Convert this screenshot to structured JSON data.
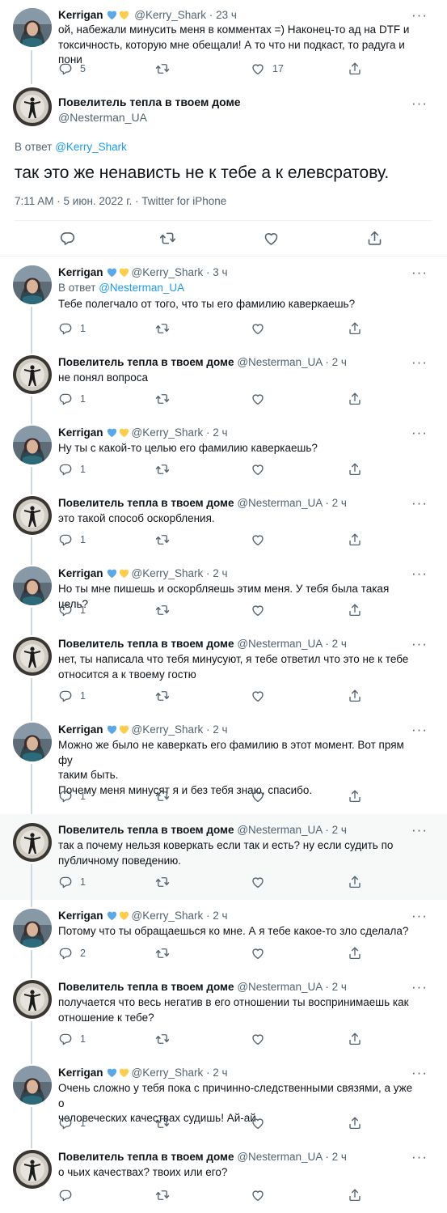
{
  "top_tweet": {
    "name": "Kerrigan",
    "handle": "@Kerry_Shark",
    "time": "23 ч",
    "text": "ой, набежали минусить меня в комментах =) Наконец-то ад на DTF и\nтоксичность, которую мне обещали! А то что ни подкаст, то радуга и пони",
    "replies": "5",
    "likes": "17"
  },
  "main_tweet": {
    "name": "Повелитель тепла в твоем доме",
    "handle": "@Nesterman_UA",
    "reply_prefix": "В ответ",
    "reply_to": "@Kerry_Shark",
    "text": "так это же ненависть не к тебе а к елевсратову.",
    "timestamp": "7:11 AM · 5 июн. 2022 г. · Twitter for iPhone"
  },
  "more_label": "···",
  "dot": "·",
  "colors": {
    "accent": "#1d9bf0",
    "secondary_text": "#536471",
    "heart_blue": "#5aa9e6",
    "heart_yellow": "#ffcc4d",
    "highlight_bg": "#f7f9f9"
  },
  "icons": [
    "reply-icon",
    "retweet-icon",
    "like-icon",
    "share-icon",
    "more-icon",
    "blue-heart-icon",
    "yellow-heart-icon"
  ],
  "replies": [
    {
      "author": "kerrigan",
      "name": "Kerrigan",
      "handle": "@Kerry_Shark",
      "time": "3 ч",
      "reply_prefix": "В ответ",
      "reply_to": "@Nesterman_UA",
      "text": "Тебе полегчало от того, что ты его фамилию каверкаешь?",
      "replies": "1"
    },
    {
      "author": "nesterman",
      "name": "Повелитель тепла в твоем доме",
      "handle": "@Nesterman_UA",
      "time": "2 ч",
      "text": "не понял вопроса",
      "replies": "1"
    },
    {
      "author": "kerrigan",
      "name": "Kerrigan",
      "handle": "@Kerry_Shark",
      "time": "2 ч",
      "text": "Ну ты с какой-то целью его фамилию каверкаешь?",
      "replies": "1"
    },
    {
      "author": "nesterman",
      "name": "Повелитель тепла в твоем доме",
      "handle": "@Nesterman_UA",
      "time": "2 ч",
      "text": "это такой способ оскорбления.",
      "replies": "1"
    },
    {
      "author": "kerrigan",
      "name": "Kerrigan",
      "handle": "@Kerry_Shark",
      "time": "2 ч",
      "text": "Но ты мне пишешь и оскорбляешь этим меня. У тебя была такая цель?",
      "replies": "1"
    },
    {
      "author": "nesterman",
      "name": "Повелитель тепла в твоем доме",
      "handle": "@Nesterman_UA",
      "time": "2 ч",
      "text": "нет, ты написала что тебя минусуют, я тебе ответил что это не к тебе\nотносится а к твоему гостю",
      "replies": "1"
    },
    {
      "author": "kerrigan",
      "name": "Kerrigan",
      "handle": "@Kerry_Shark",
      "time": "2 ч",
      "text": "Можно же было не каверкать его фамилию в этот момент. Вот прям фу\nтаким быть.\nПочему меня минусят я и без тебя знаю, спасибо.",
      "replies": "1"
    },
    {
      "author": "nesterman",
      "name": "Повелитель тепла в твоем доме",
      "handle": "@Nesterman_UA",
      "time": "2 ч",
      "text": "так а почему нельзя коверкать если так и есть? ну если судить по\nпубличному поведению.",
      "replies": "1",
      "highlight": true
    },
    {
      "author": "kerrigan",
      "name": "Kerrigan",
      "handle": "@Kerry_Shark",
      "time": "2 ч",
      "text": "Потому что ты обращаешься ко мне. А я тебе какое-то зло сделала?",
      "replies": "2"
    },
    {
      "author": "nesterman",
      "name": "Повелитель тепла в твоем доме",
      "handle": "@Nesterman_UA",
      "time": "2 ч",
      "text": "получается что весь негатив в его отношении ты воспринимаешь как\nотношение к тебе?",
      "replies": "1"
    },
    {
      "author": "kerrigan",
      "name": "Kerrigan",
      "handle": "@Kerry_Shark",
      "time": "2 ч",
      "text": "Очень сложно у тебя пока с причинно-следственными связями, а уже о\nчеловеческих качествах судишь! Ай-ай",
      "replies": "1"
    },
    {
      "author": "nesterman",
      "name": "Повелитель тепла в твоем доме",
      "handle": "@Nesterman_UA",
      "time": "2 ч",
      "text": "о чьих качествах? твоих или его?",
      "replies": ""
    }
  ]
}
